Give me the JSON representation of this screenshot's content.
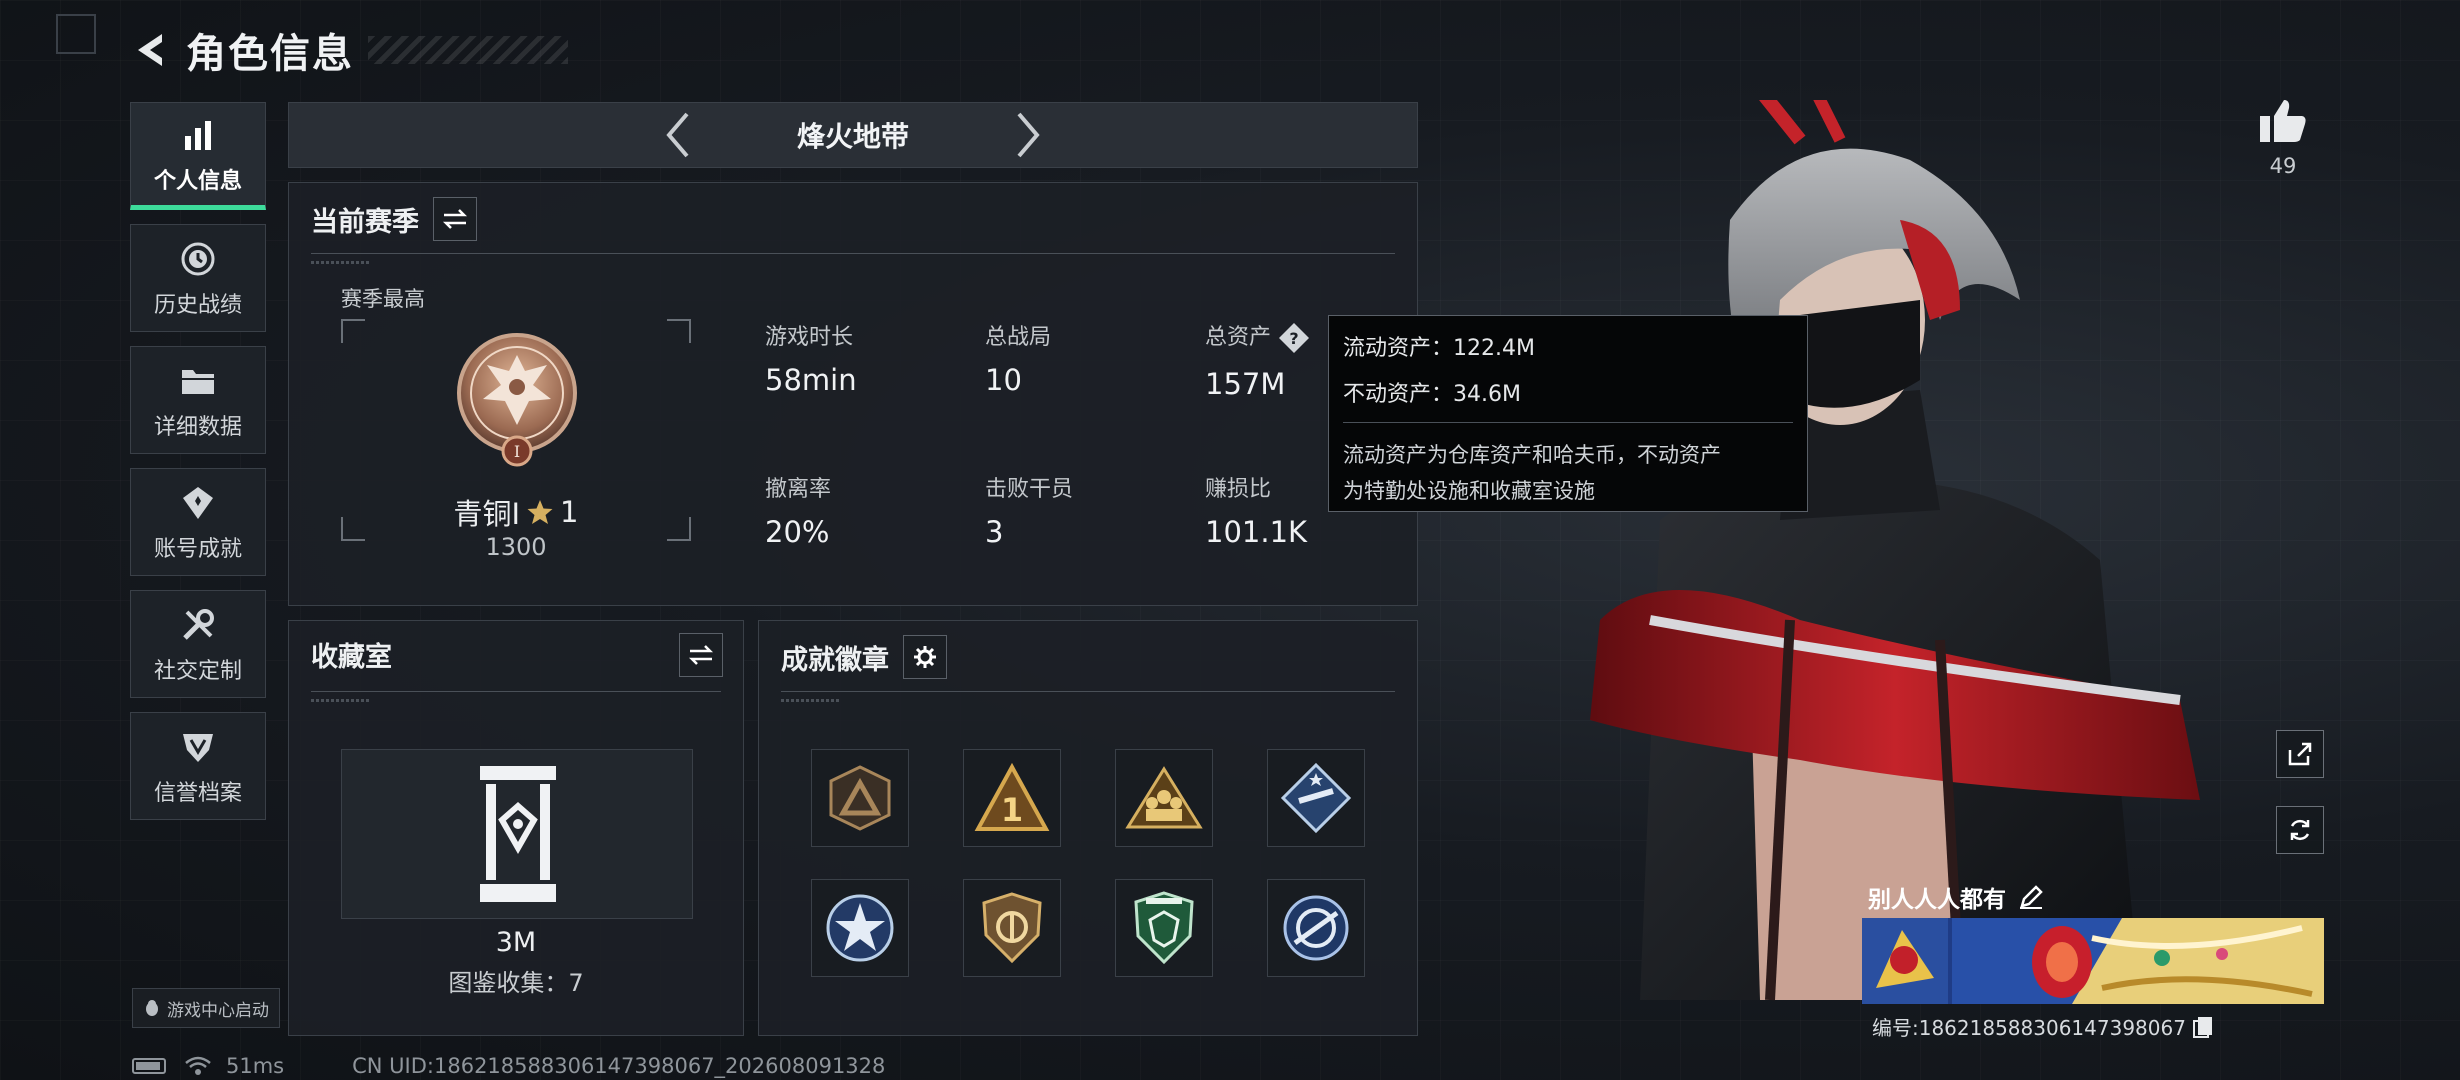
{
  "header": {
    "title": "角色信息"
  },
  "sidebar": {
    "items": [
      {
        "label": "个人信息",
        "icon": "bar-chart-icon",
        "active": true
      },
      {
        "label": "历史战绩",
        "icon": "history-icon"
      },
      {
        "label": "详细数据",
        "icon": "folder-icon"
      },
      {
        "label": "账号成就",
        "icon": "achievement-icon"
      },
      {
        "label": "社交定制",
        "icon": "wrench-icon"
      },
      {
        "label": "信誉档案",
        "icon": "credit-icon"
      }
    ],
    "game_center_label": "游戏中心启动"
  },
  "mode": {
    "title": "烽火地带"
  },
  "season": {
    "title": "当前赛季",
    "best_label": "赛季最高",
    "rank_name": "青铜I",
    "rank_stars": "1",
    "rank_score": "1300",
    "rank_badge_numeral": "I",
    "stats": [
      {
        "label": "游戏时长",
        "value": "58min"
      },
      {
        "label": "总战局",
        "value": "10"
      },
      {
        "label": "总资产",
        "value": "157M"
      },
      {
        "label": "撤离率",
        "value": "20%"
      },
      {
        "label": "击败干员",
        "value": "3"
      },
      {
        "label": "赚损比",
        "value": "101.1K"
      }
    ]
  },
  "tooltip": {
    "liquid": "流动资产：122.4M",
    "fixed": "不动资产：34.6M",
    "desc_line1": "流动资产为仓库资产和哈夫币，不动资产",
    "desc_line2": "为特勤处设施和收藏室设施"
  },
  "collection": {
    "title": "收藏室",
    "value": "3M",
    "count": "图鉴收集：7"
  },
  "badges": {
    "title": "成就徽章",
    "items": [
      {
        "name": "badge-bronze-triangle",
        "color": "#a8865a"
      },
      {
        "name": "badge-number-one",
        "color": "#c9a050"
      },
      {
        "name": "badge-squad",
        "color": "#d6b060"
      },
      {
        "name": "badge-blue-star",
        "color": "#8fb0d8"
      },
      {
        "name": "badge-star-ring",
        "color": "#8fb0d8"
      },
      {
        "name": "badge-gold-shield",
        "color": "#c9a050"
      },
      {
        "name": "badge-green-shield",
        "color": "#3f9f6a"
      },
      {
        "name": "badge-blue-emblem",
        "color": "#5f86c8"
      }
    ]
  },
  "like": {
    "count": "49"
  },
  "card": {
    "label": "别人人人都有",
    "id": "编号:18621858830614739806​7"
  },
  "footer": {
    "ping": "51ms",
    "uid": "CN UID:18621858830614739806​7_202608091328"
  },
  "colors": {
    "accent": "#3ddc9b",
    "panel_bg": "#1c2026",
    "border": "#3a4048"
  }
}
